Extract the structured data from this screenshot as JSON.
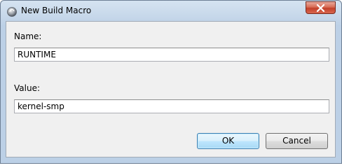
{
  "window": {
    "title": "New Build Macro"
  },
  "form": {
    "name_label": "Name:",
    "name_value": "RUNTIME",
    "value_label": "Value:",
    "value_value": "kernel-smp"
  },
  "buttons": {
    "ok_label": "OK",
    "cancel_label": "Cancel"
  },
  "icons": {
    "app": "eclipse-icon",
    "close": "close-icon"
  }
}
